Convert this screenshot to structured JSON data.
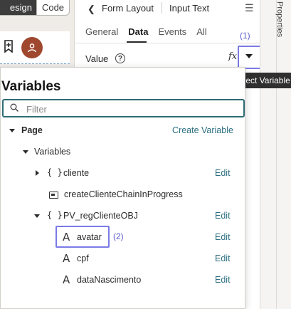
{
  "canvas": {
    "mode_tabs": [
      "esign",
      "Code"
    ]
  },
  "properties_panel": {
    "breadcrumb": [
      "Form Layout",
      "Input Text"
    ],
    "tabs": [
      {
        "label": "General",
        "active": false
      },
      {
        "label": "Data",
        "active": true
      },
      {
        "label": "Events",
        "active": false
      },
      {
        "label": "All",
        "active": false
      }
    ],
    "value_label": "Value",
    "fx_label": "fx",
    "callout_1": "(1)",
    "vertical_tab": "Properties",
    "tooltip": "Select Variable"
  },
  "variables_popup": {
    "title": "Variables",
    "filter_placeholder": "Filter",
    "page_label": "Page",
    "create_variable": "Create Variable",
    "variables_label": "Variables",
    "edit_label": "Edit",
    "items": [
      {
        "name": "cliente",
        "kind": "object",
        "expanded": false,
        "editable": true
      },
      {
        "name": "createClienteChainInProgress",
        "kind": "chain",
        "editable": false
      },
      {
        "name": "PV_regClienteOBJ",
        "kind": "object",
        "expanded": true,
        "editable": true
      }
    ],
    "children": [
      {
        "name": "avatar",
        "kind": "string",
        "highlighted": true
      },
      {
        "name": "cpf",
        "kind": "string",
        "highlighted": false
      },
      {
        "name": "dataNascimento",
        "kind": "string",
        "highlighted": false
      }
    ],
    "callout_2": "(2)"
  },
  "colors": {
    "accent_highlight": "#7b7ae6",
    "link": "#2b6f80",
    "filter_border": "#2e6d74",
    "avatar_bg": "#a0482f"
  }
}
